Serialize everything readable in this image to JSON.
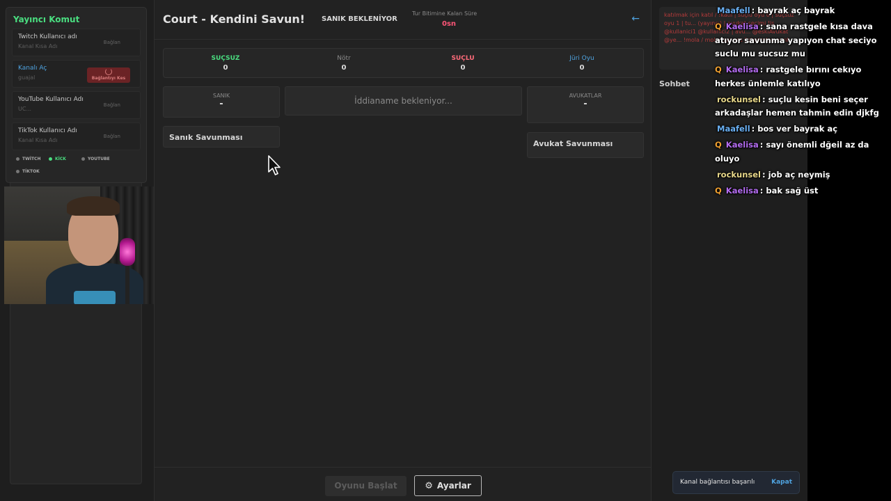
{
  "streamer_panel": {
    "title": "Yayıncı Komut",
    "connections": [
      {
        "name": "Twitch Kullanıcı adı",
        "sub": "Kanal Kısa Adı",
        "action": "Bağlan"
      },
      {
        "name": "Kanalı Aç",
        "sub": "guajal",
        "action": "Bağlantıyı Kes"
      },
      {
        "name": "YouTube Kullanıcı Adı",
        "sub": "UC...",
        "action": "Bağlan"
      },
      {
        "name": "TikTok Kullanıcı Adı",
        "sub": "Kanal Kısa Adı",
        "action": "Bağlan"
      }
    ],
    "platforms": [
      "TWİTCH",
      "KİCK",
      "YOUTUBE",
      "TİKTOK"
    ]
  },
  "header": {
    "title": "Court - Kendini Savun!",
    "phase": "SANIK BEKLENİYOR",
    "timer_label": "Tur Bitimine Kalan Süre",
    "timer_value": "0sn",
    "back_icon": "arrow-left-icon"
  },
  "votes": [
    {
      "label": "SUÇSUZ",
      "value": "0"
    },
    {
      "label": "Nötr",
      "value": "0"
    },
    {
      "label": "SUÇLU",
      "value": "0"
    },
    {
      "label": "Jüri Oyu",
      "value": "0"
    }
  ],
  "court": {
    "defendant_label": "SANIK",
    "defendant_value": "-",
    "indictment_placeholder": "İddianame bekleniyor...",
    "lawyers_label": "AVUKATLAR",
    "lawyers_value": "-",
    "defendant_defense": "Sanık Savunması",
    "lawyer_defense": "Avukat Savunması"
  },
  "footer": {
    "start_label": "Oyunu Başlat",
    "settings_label": "Ayarlar"
  },
  "commands_text": "katılmak için katıl / !katıl | suçlu oyu 0 | suçsuz oyu 1 | tu... (yayıncı) | avukat seçimi !is @kullanici1 @kullanici2 | avu... @eskiAvukat @ye... !mola / mola: oyuncu listesinden ayrıl",
  "chat_tab": "Sohbet",
  "toast": {
    "message": "Kanal bağlantısı başarılı",
    "close": "Kapat"
  },
  "chat_messages": [
    {
      "badge": "",
      "user": "Maafell",
      "color": "#6ab0f3",
      "text": ": bayrak aç bayrak"
    },
    {
      "badge": "Q",
      "user": "Kaelisa",
      "color": "#b36cf0",
      "text": ": sana rastgele kısa dava atıyor savunma yapıyon chat seciyo suclu mu sucsuz mu"
    },
    {
      "badge": "Q",
      "user": "Kaelisa",
      "color": "#b36cf0",
      "text": ": rastgele bırını cekıyo herkes ünlemle katılıyo"
    },
    {
      "badge": "",
      "user": "rockunsel",
      "color": "#e8d88a",
      "text": ": suçlu kesin beni seçer arkadaşlar hemen tahmin edin djkfg"
    },
    {
      "badge": "",
      "user": "Maafell",
      "color": "#6ab0f3",
      "text": ": bos ver bayrak aç"
    },
    {
      "badge": "Q",
      "user": "Kaelisa",
      "color": "#b36cf0",
      "text": ": sayı önemli dğeil az da oluyo"
    },
    {
      "badge": "",
      "user": "rockunsel",
      "color": "#e8d88a",
      "text": ": job aç neymiş"
    },
    {
      "badge": "Q",
      "user": "Kaelisa",
      "color": "#b36cf0",
      "text": ": bak sağ üst"
    }
  ]
}
